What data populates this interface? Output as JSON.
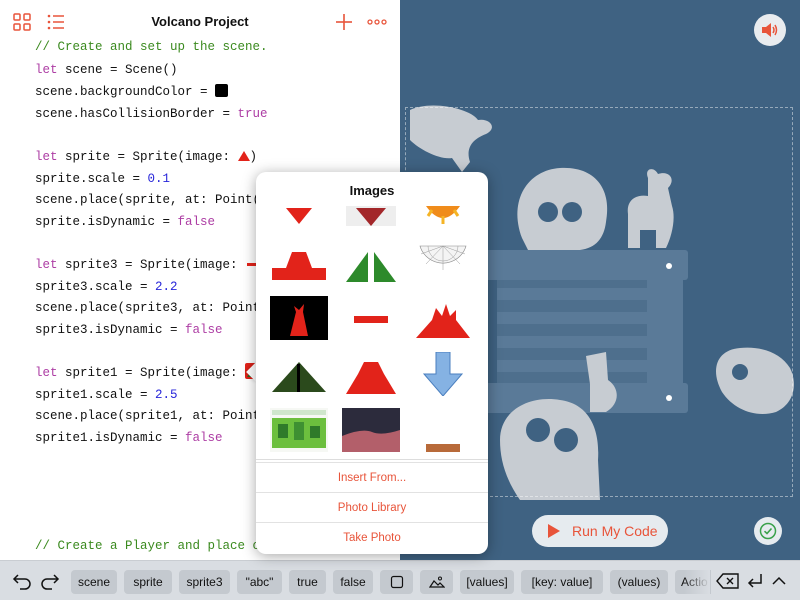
{
  "header": {
    "title": "Volcano Project"
  },
  "code": {
    "lines": [
      "// Create and set up the scene.",
      "let scene = Scene()",
      "scene.backgroundColor = ",
      "scene.hasCollisionBorder = true",
      "let sprite = Sprite(image: ",
      "sprite.scale = 0.1",
      "scene.place(sprite, at: Point(x",
      "sprite.isDynamic = false",
      "let sprite3 = Sprite(image: ",
      "sprite3.scale = 2.2",
      "scene.place(sprite3, at: Point(",
      "sprite3.isDynamic = false",
      "let sprite1 = Sprite(image: ",
      "sprite1.scale = 2.5",
      "scene.place(sprite1, at: Point(",
      "sprite1.isDynamic = false",
      "// Create a Player and place on"
    ],
    "tokens": {
      "let": "let",
      "true": "true",
      "false": "false",
      "num_0_1": "0.1",
      "num_2_2": "2.2",
      "num_2_5": "2.5",
      "scene_decl": " scene = Scene()",
      "bgcolor": "scene.backgroundColor = ",
      "collision": "scene.hasCollisionBorder = ",
      "sprite_decl": " sprite = Sprite(image: ",
      "sprite_scale": "sprite.scale = ",
      "sprite_place": "scene.place(sprite, at: Point(x",
      "sprite_dyn": "sprite.isDynamic = ",
      "sprite3_decl": " sprite3 = Sprite(image: ",
      "sprite3_scale": "sprite3.scale = ",
      "sprite3_place": "scene.place(sprite3, at: Point(",
      "sprite3_dyn": "sprite3.isDynamic = ",
      "sprite1_decl": " sprite1 = Sprite(image: ",
      "sprite1_scale": "sprite1.scale = ",
      "sprite1_place": "scene.place(sprite1, at: Point(",
      "sprite1_dyn": "sprite1.isDynamic = ",
      "close_paren": ")"
    }
  },
  "live_view": {
    "run_label": "Run My Code"
  },
  "popover": {
    "title": "Images",
    "actions": [
      "Insert From...",
      "Photo Library",
      "Take Photo"
    ]
  },
  "toolbar": {
    "chips": [
      "scene",
      "sprite",
      "sprite3",
      "\"abc\"",
      "true",
      "false",
      "[values]",
      "[key: value]",
      "(values)",
      "Actio"
    ]
  },
  "colors": {
    "accent": "#e8543a",
    "live_bg": "#3f6282",
    "keyword": "#ad3da4",
    "number": "#2725d9",
    "comment": "#3b8a1f"
  },
  "icons": {
    "top_left": [
      "grid-icon",
      "list-icon"
    ],
    "top_right": [
      "plus-icon",
      "more-icon"
    ],
    "bottom_left": [
      "undo-icon",
      "redo-icon"
    ],
    "bottom_right": [
      "backspace-icon",
      "return-icon",
      "chevron-up-icon"
    ],
    "live": [
      "speaker-icon",
      "play-icon",
      "checkmark-icon"
    ]
  }
}
